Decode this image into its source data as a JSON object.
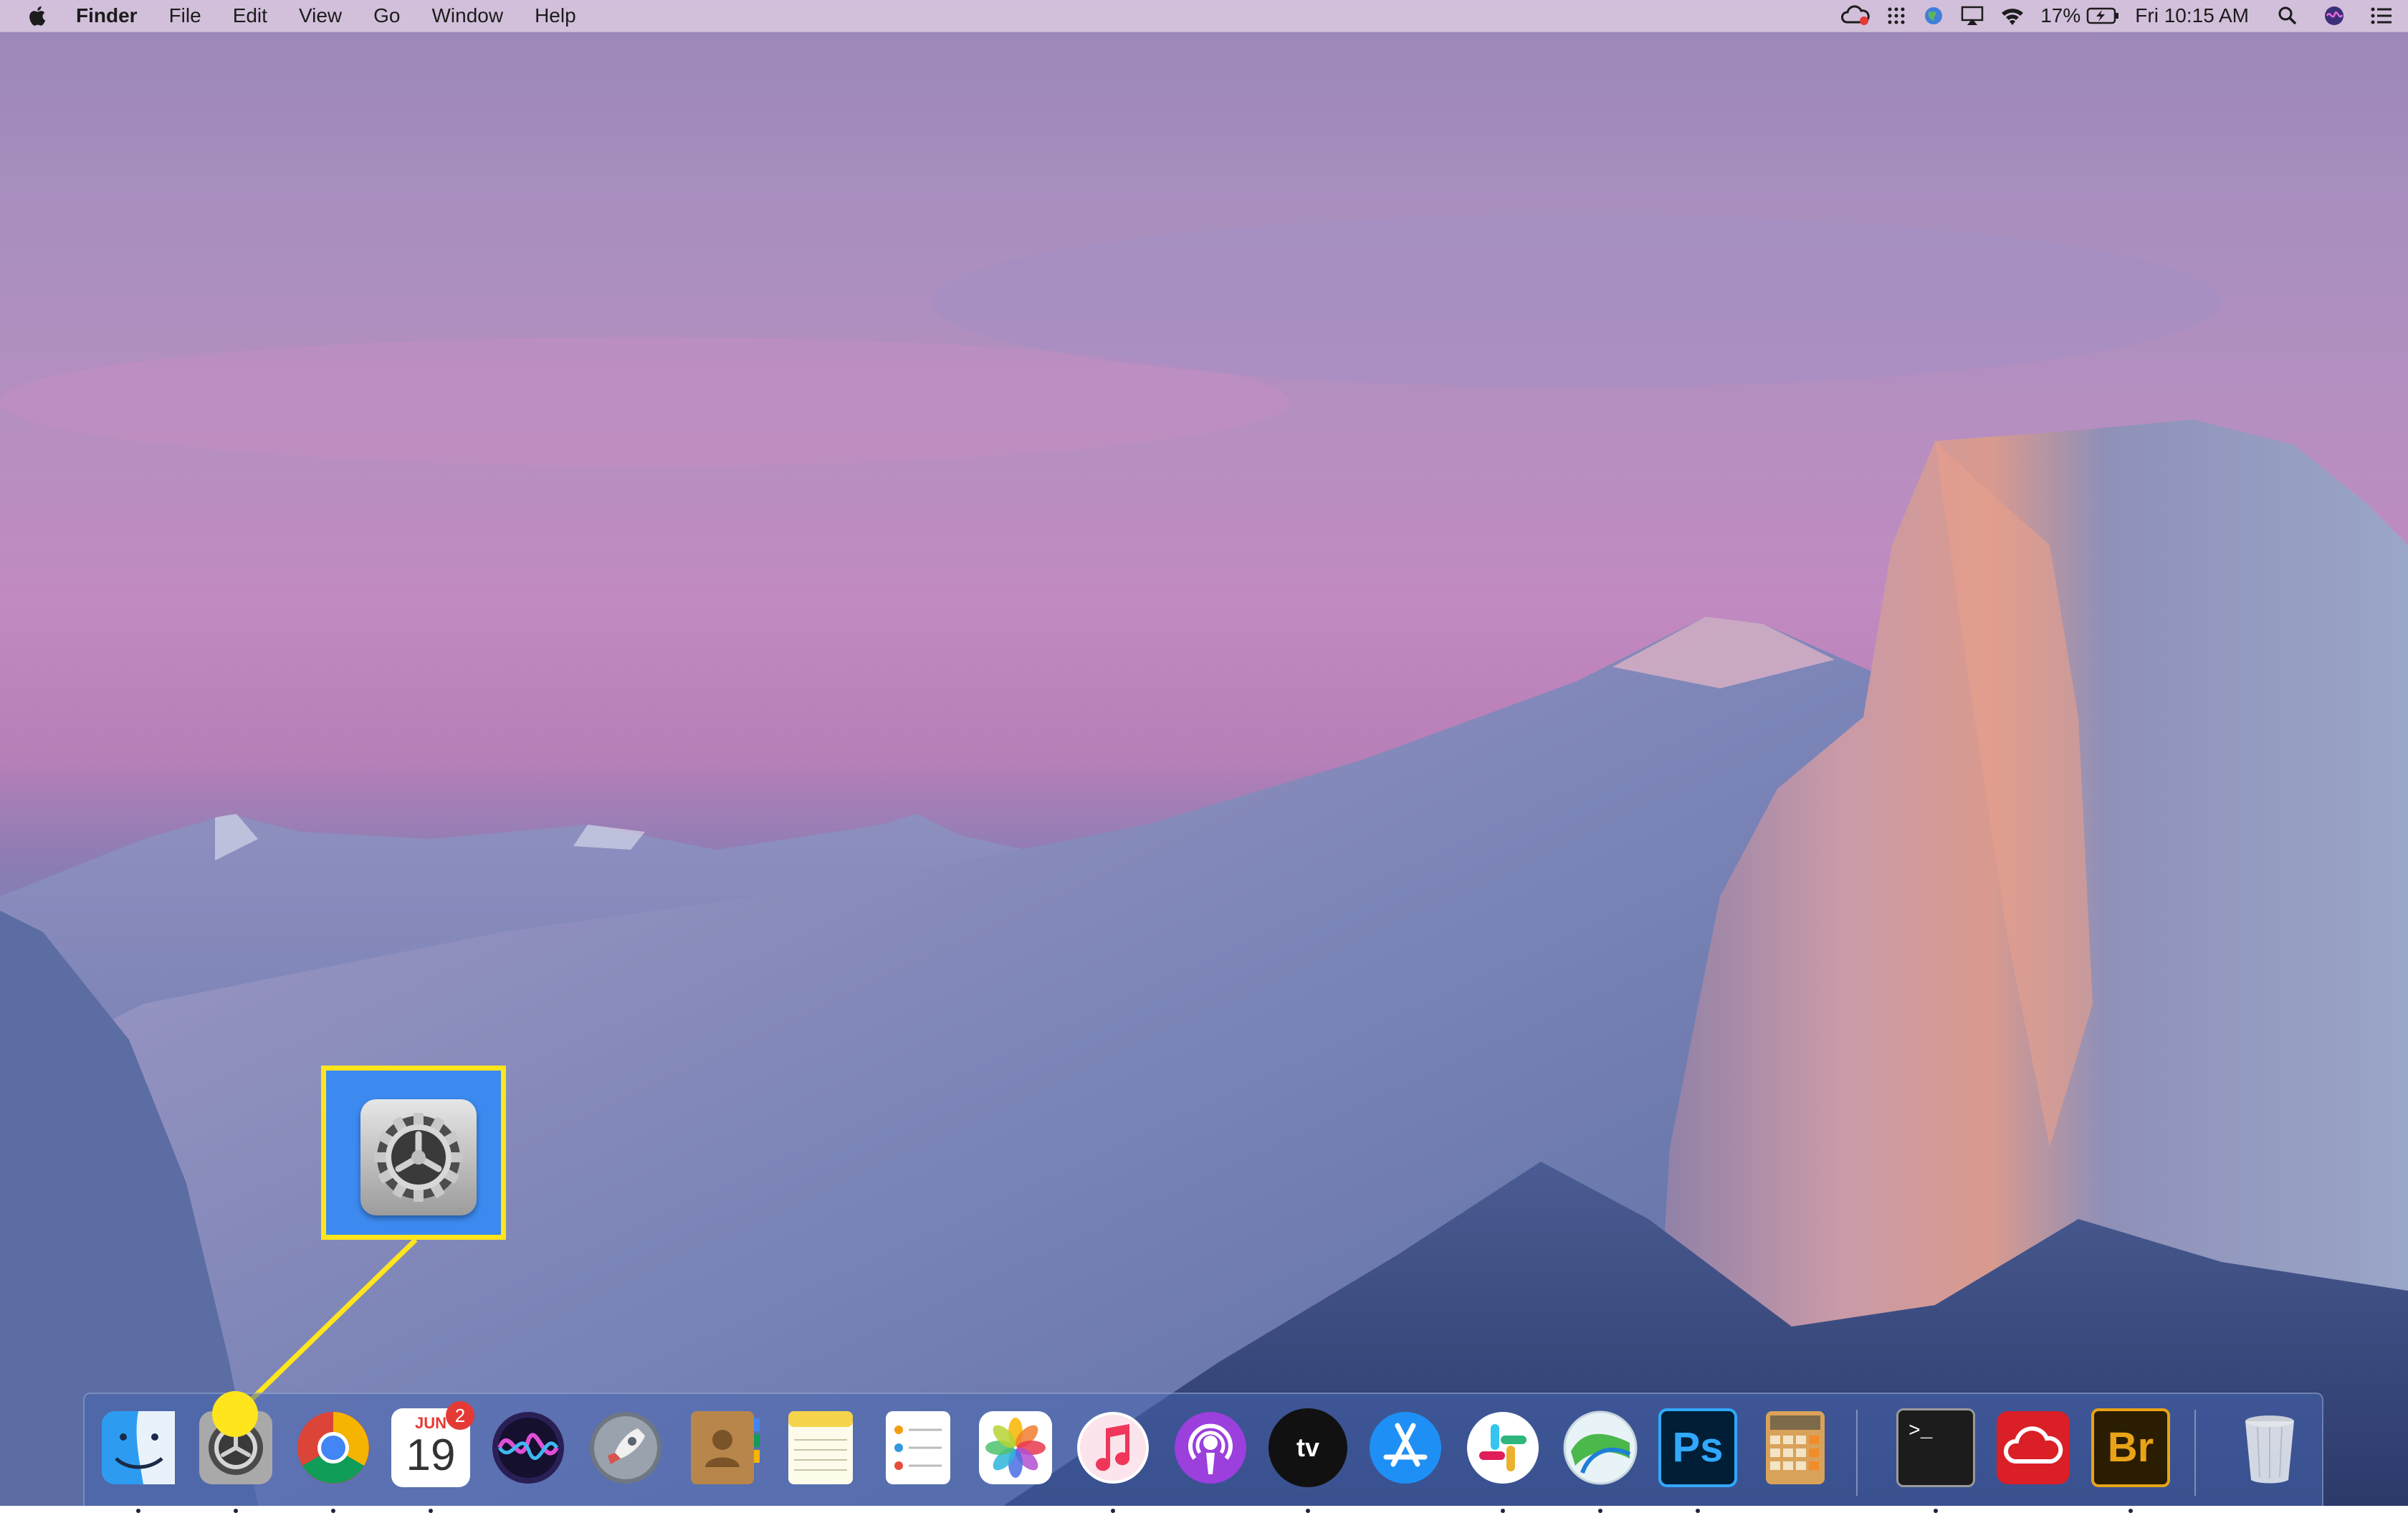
{
  "menubar": {
    "apple_icon": "apple-logo-icon",
    "items": [
      "Finder",
      "File",
      "Edit",
      "View",
      "Go",
      "Window",
      "Help"
    ],
    "status": {
      "icons": [
        "creative-cloud-icon",
        "grid-menu-icon",
        "globe-icon",
        "airplay-icon",
        "wifi-icon"
      ],
      "battery_percent": "17%",
      "clock": "Fri 10:15 AM",
      "right_icons": [
        "spotlight-search-icon",
        "siri-icon",
        "notification-center-icon"
      ]
    }
  },
  "callout": {
    "icon": "system-preferences-icon",
    "highlight_color": "#ffe51c"
  },
  "dock": {
    "apps": [
      {
        "name": "Finder",
        "icon": "finder-icon",
        "running": true
      },
      {
        "name": "System Preferences",
        "icon": "system-preferences-icon",
        "running": true
      },
      {
        "name": "Google Chrome",
        "icon": "chrome-icon",
        "running": true
      },
      {
        "name": "Calendar",
        "icon": "calendar-icon",
        "running": true,
        "month": "JUN",
        "day": "19",
        "badge": "2"
      },
      {
        "name": "Siri",
        "icon": "siri-icon",
        "running": false
      },
      {
        "name": "Launchpad",
        "icon": "launchpad-icon",
        "running": false
      },
      {
        "name": "Contacts",
        "icon": "contacts-icon",
        "running": false
      },
      {
        "name": "Notes",
        "icon": "notes-icon",
        "running": false
      },
      {
        "name": "Reminders",
        "icon": "reminders-icon",
        "running": false
      },
      {
        "name": "Photos",
        "icon": "photos-icon",
        "running": false
      },
      {
        "name": "Music",
        "icon": "music-icon",
        "running": true
      },
      {
        "name": "Podcasts",
        "icon": "podcasts-icon",
        "running": false
      },
      {
        "name": "TV",
        "icon": "apple-tv-icon",
        "running": true,
        "label": "tv"
      },
      {
        "name": "App Store",
        "icon": "app-store-icon",
        "running": false
      },
      {
        "name": "Slack",
        "icon": "slack-icon",
        "running": true
      },
      {
        "name": "Network",
        "icon": "network-globe-icon",
        "running": true
      },
      {
        "name": "Photoshop",
        "icon": "photoshop-icon",
        "running": true,
        "label": "Ps"
      },
      {
        "name": "Calculator",
        "icon": "calculator-icon",
        "running": false
      },
      {
        "name": "Terminal",
        "icon": "terminal-icon",
        "running": true,
        "label": ">_"
      },
      {
        "name": "Creative Cloud",
        "icon": "creative-cloud-icon",
        "running": false
      },
      {
        "name": "Bridge",
        "icon": "bridge-icon",
        "running": true,
        "label": "Br"
      },
      {
        "name": "Trash",
        "icon": "trash-icon",
        "running": false
      }
    ]
  }
}
